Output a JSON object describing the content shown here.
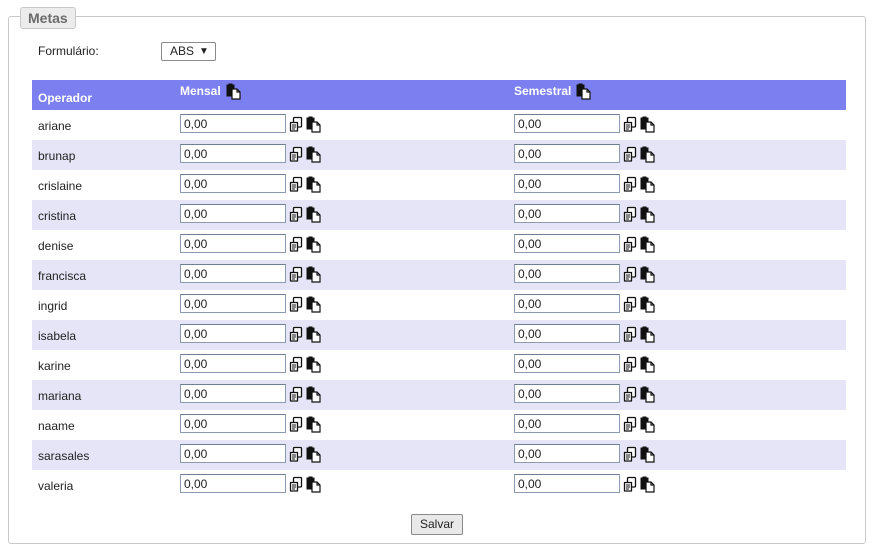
{
  "fieldset": {
    "legend": "Metas"
  },
  "form": {
    "label": "Formulário:",
    "selected": "ABS"
  },
  "table": {
    "headers": {
      "operator": "Operador",
      "monthly": "Mensal",
      "semester": "Semestral"
    },
    "rows": [
      {
        "name": "ariane",
        "monthly": "0,00",
        "semester": "0,00"
      },
      {
        "name": "brunap",
        "monthly": "0,00",
        "semester": "0,00"
      },
      {
        "name": "crislaine",
        "monthly": "0,00",
        "semester": "0,00"
      },
      {
        "name": "cristina",
        "monthly": "0,00",
        "semester": "0,00"
      },
      {
        "name": "denise",
        "monthly": "0,00",
        "semester": "0,00"
      },
      {
        "name": "francisca",
        "monthly": "0,00",
        "semester": "0,00"
      },
      {
        "name": "ingrid",
        "monthly": "0,00",
        "semester": "0,00"
      },
      {
        "name": "isabela",
        "monthly": "0,00",
        "semester": "0,00"
      },
      {
        "name": "karine",
        "monthly": "0,00",
        "semester": "0,00"
      },
      {
        "name": "mariana",
        "monthly": "0,00",
        "semester": "0,00"
      },
      {
        "name": "naame",
        "monthly": "0,00",
        "semester": "0,00"
      },
      {
        "name": "sarasales",
        "monthly": "0,00",
        "semester": "0,00"
      },
      {
        "name": "valeria",
        "monthly": "0,00",
        "semester": "0,00"
      }
    ]
  },
  "actions": {
    "save_label": "Salvar"
  },
  "icons": {
    "copy": "copy-icon",
    "paste": "paste-icon",
    "dropdown": "dropdown-arrow-icon"
  },
  "colors": {
    "header_bg": "#7b7ff0",
    "alt_row_bg": "#e5e5f7",
    "legend_bg": "#ececec"
  }
}
